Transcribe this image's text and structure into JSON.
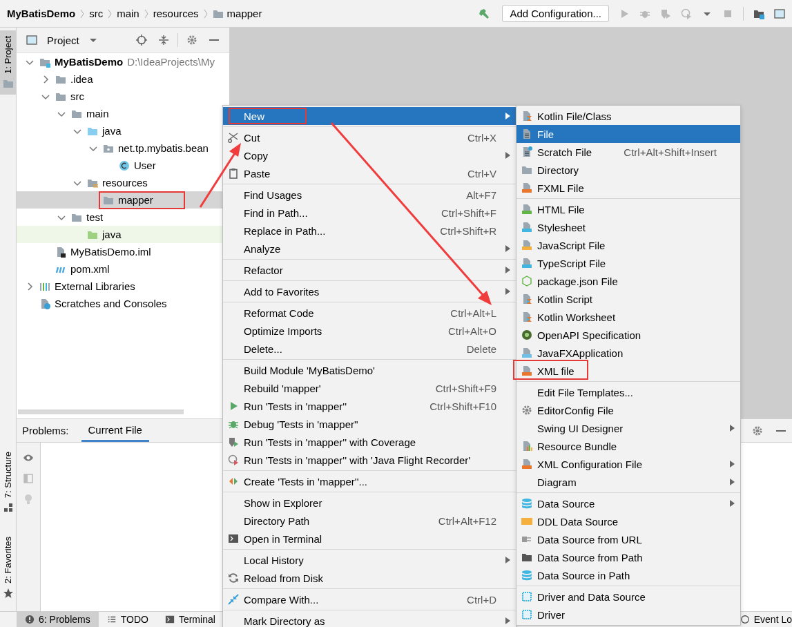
{
  "breadcrumbs": [
    {
      "label": "MyBatisDemo"
    },
    {
      "label": "src"
    },
    {
      "label": "main"
    },
    {
      "label": "resources"
    },
    {
      "label": "mapper",
      "kind": "folder"
    }
  ],
  "toolbar": {
    "config_button": "Add Configuration..."
  },
  "left_stripe": [
    {
      "label": "1: Project",
      "kind": "folder",
      "selected": true
    },
    {
      "label": "7: Structure",
      "kind": "structure",
      "selected": false
    },
    {
      "label": "2: Favorites",
      "kind": "star",
      "selected": false
    }
  ],
  "project_panel": {
    "title": "Project",
    "tree": [
      {
        "label": "MyBatisDemo",
        "path": "D:\\IdeaProjects\\My",
        "kind": "module",
        "expanded": true,
        "selected": false,
        "children": [
          {
            "label": ".idea",
            "kind": "folder",
            "expanded": false,
            "selected": false
          },
          {
            "label": "src",
            "kind": "folder",
            "expanded": true,
            "selected": false,
            "children": [
              {
                "label": "main",
                "kind": "folder",
                "expanded": true,
                "selected": false,
                "children": [
                  {
                    "label": "java",
                    "kind": "srcfolder",
                    "expanded": true,
                    "selected": false,
                    "children": [
                      {
                        "label": "net.tp.mybatis.bean",
                        "kind": "package",
                        "expanded": true,
                        "selected": false,
                        "children": [
                          {
                            "label": "User",
                            "kind": "class",
                            "selected": false
                          }
                        ]
                      }
                    ]
                  },
                  {
                    "label": "resources",
                    "kind": "resfolder",
                    "expanded": true,
                    "selected": false,
                    "children": [
                      {
                        "label": "mapper",
                        "kind": "folder",
                        "selected": true,
                        "annotated": true
                      }
                    ]
                  }
                ]
              },
              {
                "label": "test",
                "kind": "folder",
                "expanded": true,
                "selected": false,
                "children": [
                  {
                    "label": "java",
                    "kind": "testfolder",
                    "selected": false
                  }
                ]
              }
            ]
          },
          {
            "label": "MyBatisDemo.iml",
            "kind": "iml",
            "selected": false
          },
          {
            "label": "pom.xml",
            "kind": "maven",
            "selected": false
          }
        ]
      },
      {
        "label": "External Libraries",
        "kind": "libs",
        "expanded": false,
        "selected": false
      },
      {
        "label": "Scratches and Consoles",
        "kind": "scratches",
        "selected": false
      }
    ]
  },
  "problems_panel": {
    "label": "Problems:",
    "tabs": [
      {
        "label": "Current File",
        "selected": true
      }
    ]
  },
  "status_bar": {
    "tabs": [
      {
        "label": "6: Problems",
        "kind": "info",
        "selected": true
      },
      {
        "label": "TODO",
        "kind": "list",
        "selected": false
      },
      {
        "label": "Terminal",
        "kind": "terminal",
        "selected": false
      }
    ],
    "event_log": "Event Lo"
  },
  "context_menu": {
    "sections": [
      [
        {
          "label": "New",
          "selected": true,
          "submenu": true,
          "annotated": true
        }
      ],
      [
        {
          "label": "Cut",
          "kind": "scissors",
          "shortcut": "Ctrl+X",
          "selected": false
        },
        {
          "label": "Copy",
          "submenu": true,
          "selected": false
        },
        {
          "label": "Paste",
          "kind": "clipboard",
          "shortcut": "Ctrl+V",
          "selected": false
        }
      ],
      [
        {
          "label": "Find Usages",
          "shortcut": "Alt+F7",
          "selected": false
        },
        {
          "label": "Find in Path...",
          "shortcut": "Ctrl+Shift+F",
          "selected": false
        },
        {
          "label": "Replace in Path...",
          "shortcut": "Ctrl+Shift+R",
          "selected": false
        },
        {
          "label": "Analyze",
          "submenu": true,
          "selected": false
        }
      ],
      [
        {
          "label": "Refactor",
          "submenu": true,
          "selected": false
        }
      ],
      [
        {
          "label": "Add to Favorites",
          "submenu": true,
          "selected": false
        }
      ],
      [
        {
          "label": "Reformat Code",
          "shortcut": "Ctrl+Alt+L",
          "selected": false
        },
        {
          "label": "Optimize Imports",
          "shortcut": "Ctrl+Alt+O",
          "selected": false
        },
        {
          "label": "Delete...",
          "shortcut": "Delete",
          "selected": false
        }
      ],
      [
        {
          "label": "Build Module 'MyBatisDemo'",
          "selected": false
        },
        {
          "label": "Rebuild 'mapper'",
          "shortcut": "Ctrl+Shift+F9",
          "selected": false
        },
        {
          "label": "Run 'Tests in 'mapper''",
          "kind": "run",
          "shortcut": "Ctrl+Shift+F10",
          "selected": false
        },
        {
          "label": "Debug 'Tests in 'mapper''",
          "kind": "bug",
          "selected": false
        },
        {
          "label": "Run 'Tests in 'mapper'' with Coverage",
          "kind": "coverage",
          "selected": false
        },
        {
          "label": "Run 'Tests in 'mapper'' with 'Java Flight Recorder'",
          "kind": "profiler",
          "selected": false
        }
      ],
      [
        {
          "label": "Create 'Tests in 'mapper''...",
          "kind": "create",
          "selected": false
        }
      ],
      [
        {
          "label": "Show in Explorer",
          "selected": false
        },
        {
          "label": "Directory Path",
          "shortcut": "Ctrl+Alt+F12",
          "selected": false
        },
        {
          "label": "Open in Terminal",
          "kind": "terminal",
          "selected": false
        }
      ],
      [
        {
          "label": "Local History",
          "submenu": true,
          "selected": false
        },
        {
          "label": "Reload from Disk",
          "kind": "reload",
          "selected": false
        }
      ],
      [
        {
          "label": "Compare With...",
          "kind": "compare",
          "shortcut": "Ctrl+D",
          "selected": false
        }
      ],
      [
        {
          "label": "Mark Directory as",
          "submenu": true,
          "selected": false
        }
      ]
    ]
  },
  "new_submenu": {
    "sections": [
      [
        {
          "label": "Kotlin File/Class",
          "kind": "kotlin",
          "selected": false
        },
        {
          "label": "File",
          "kind": "file",
          "selected": true
        },
        {
          "label": "Scratch File",
          "kind": "scratch",
          "shortcut": "Ctrl+Alt+Shift+Insert",
          "selected": false
        },
        {
          "label": "Directory",
          "kind": "folder",
          "selected": false
        },
        {
          "label": "FXML File",
          "kind": "xml",
          "selected": false
        }
      ],
      [
        {
          "label": "HTML File",
          "kind": "html",
          "selected": false
        },
        {
          "label": "Stylesheet",
          "kind": "css",
          "selected": false
        },
        {
          "label": "JavaScript File",
          "kind": "js",
          "selected": false
        },
        {
          "label": "TypeScript File",
          "kind": "ts",
          "selected": false
        },
        {
          "label": "package.json File",
          "kind": "nodejs",
          "selected": false
        },
        {
          "label": "Kotlin Script",
          "kind": "kotlin",
          "selected": false
        },
        {
          "label": "Kotlin Worksheet",
          "kind": "kotlin",
          "selected": false
        },
        {
          "label": "OpenAPI Specification",
          "kind": "openapi",
          "selected": false
        },
        {
          "label": "JavaFXApplication",
          "kind": "javafx",
          "selected": false
        },
        {
          "label": "XML file",
          "kind": "xml",
          "selected": false,
          "annotated": true
        }
      ],
      [
        {
          "label": "Edit File Templates...",
          "selected": false
        },
        {
          "label": "EditorConfig File",
          "kind": "gear",
          "selected": false
        },
        {
          "label": "Swing UI Designer",
          "submenu": true,
          "selected": false
        },
        {
          "label": "Resource Bundle",
          "kind": "bundle",
          "selected": false
        },
        {
          "label": "XML Configuration File",
          "kind": "xml",
          "submenu": true,
          "selected": false
        },
        {
          "label": "Diagram",
          "submenu": true,
          "selected": false
        }
      ],
      [
        {
          "label": "Data Source",
          "kind": "db",
          "submenu": true,
          "selected": false
        },
        {
          "label": "DDL Data Source",
          "kind": "ddl",
          "selected": false
        },
        {
          "label": "Data Source from URL",
          "kind": "dburl",
          "selected": false
        },
        {
          "label": "Data Source from Path",
          "kind": "dbfolder",
          "selected": false
        },
        {
          "label": "Data Source in Path",
          "kind": "db",
          "selected": false
        }
      ],
      [
        {
          "label": "Driver and Data Source",
          "kind": "driver",
          "selected": false
        },
        {
          "label": "Driver",
          "kind": "driver",
          "selected": false
        }
      ]
    ]
  }
}
